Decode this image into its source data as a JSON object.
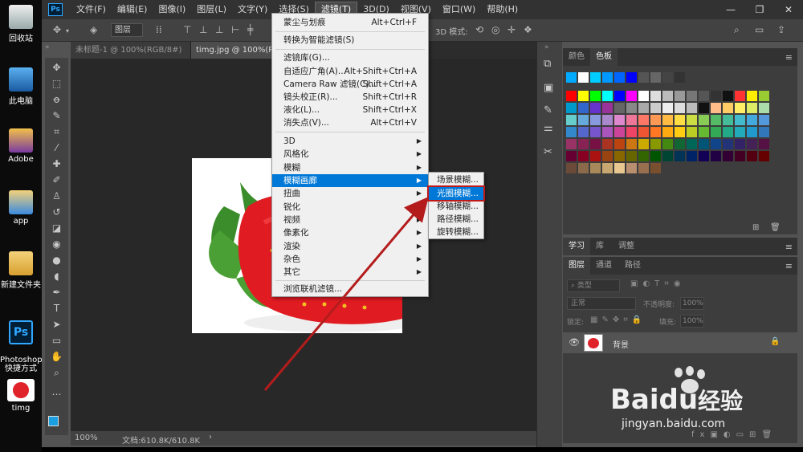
{
  "desktop": {
    "icons": [
      {
        "label": "回收站"
      },
      {
        "label": "此电脑"
      },
      {
        "label": "Adobe"
      },
      {
        "label": "app"
      },
      {
        "label": "新建文件夹"
      },
      {
        "label": "Photoshop\n快捷方式"
      },
      {
        "label": "timg"
      }
    ]
  },
  "menubar": {
    "logo": "Ps",
    "items": [
      "文件(F)",
      "编辑(E)",
      "图像(I)",
      "图层(L)",
      "文字(Y)",
      "选择(S)",
      "滤镜(T)",
      "3D(D)",
      "视图(V)",
      "窗口(W)",
      "帮助(H)"
    ],
    "active_index": 6
  },
  "options": {
    "layer_select": "图层",
    "mode_3d": "3D 模式:"
  },
  "tabs": [
    {
      "label": "未标题-1 @ 100%(RGB/8#)"
    },
    {
      "label": "timg.jpg @ 100%(RGB/"
    }
  ],
  "filter_menu": {
    "items": [
      {
        "label": "蒙尘与划痕",
        "shortcut": "Alt+Ctrl+F"
      },
      {
        "label": "转换为智能滤镜(S)",
        "shortcut": ""
      },
      {
        "label": "滤镜库(G)...",
        "shortcut": ""
      },
      {
        "label": "自适应广角(A)...",
        "shortcut": "Alt+Shift+Ctrl+A"
      },
      {
        "label": "Camera Raw 滤镜(C)...",
        "shortcut": "Shift+Ctrl+A"
      },
      {
        "label": "镜头校正(R)...",
        "shortcut": "Shift+Ctrl+R"
      },
      {
        "label": "液化(L)...",
        "shortcut": "Shift+Ctrl+X"
      },
      {
        "label": "消失点(V)...",
        "shortcut": "Alt+Ctrl+V"
      },
      {
        "label": "3D",
        "shortcut": ""
      },
      {
        "label": "风格化",
        "shortcut": ""
      },
      {
        "label": "模糊",
        "shortcut": ""
      },
      {
        "label": "模糊画廊",
        "shortcut": ""
      },
      {
        "label": "扭曲",
        "shortcut": ""
      },
      {
        "label": "锐化",
        "shortcut": ""
      },
      {
        "label": "视频",
        "shortcut": ""
      },
      {
        "label": "像素化",
        "shortcut": ""
      },
      {
        "label": "渲染",
        "shortcut": ""
      },
      {
        "label": "杂色",
        "shortcut": ""
      },
      {
        "label": "其它",
        "shortcut": ""
      },
      {
        "label": "浏览联机滤镜...",
        "shortcut": ""
      }
    ],
    "highlighted": "模糊画廊"
  },
  "blur_gallery_submenu": {
    "items": [
      "场景模糊...",
      "光圈模糊...",
      "移轴模糊...",
      "路径模糊...",
      "旋转模糊..."
    ],
    "highlighted": "光圈模糊..."
  },
  "swatch_panel": {
    "tabs": [
      "颜色",
      "色板"
    ],
    "active_tab": "色板"
  },
  "learn_panel": {
    "tabs": [
      "学习",
      "库",
      "调整"
    ]
  },
  "layers_panel": {
    "tabs": [
      "图层",
      "通道",
      "路径"
    ],
    "filter_label": "类型",
    "blend_mode": "正常",
    "opacity_label": "不透明度:",
    "opacity_value": "100%",
    "lock_label": "锁定:",
    "fill_label": "填充:",
    "fill_value": "100%",
    "layer_name": "背景"
  },
  "status": {
    "zoom": "100%",
    "doc": "文档:610.8K/610.8K"
  },
  "watermark": {
    "brand": "Bai",
    "brand2": "du",
    "cn": "经验",
    "url": "jingyan.baidu.com"
  },
  "colors": {
    "accent": "#0078d7",
    "highlight_box": "#c11818",
    "arrow": "#b41c1c",
    "fg_color": "#1aa0e0"
  }
}
